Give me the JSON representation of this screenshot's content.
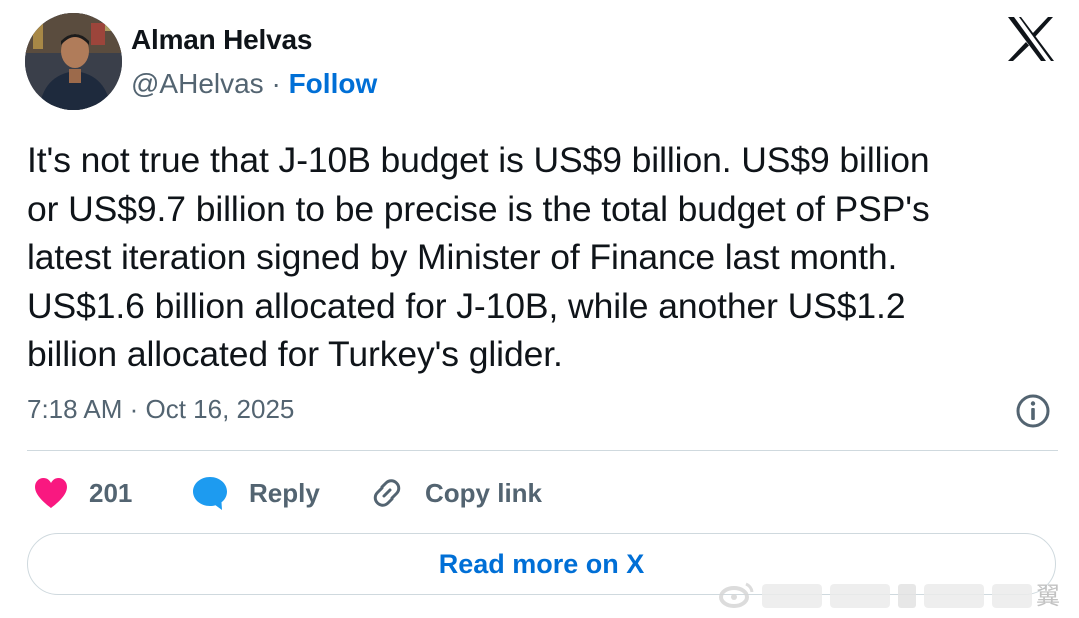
{
  "author": {
    "name": "Alman Helvas",
    "handle": "@AHelvas",
    "separator": " · ",
    "follow_label": "Follow"
  },
  "tweet": {
    "text": "It's not true that J-10B budget is US$9 billion. US$9 billion\nor US$9.7 billion to be precise is the total budget of PSP's\nlatest iteration signed by Minister of Finance last month.\nUS$1.6 billion allocated for J-10B, while another US$1.2\nbillion allocated for Turkey's glider.",
    "timestamp": "7:18 AM · Oct 16, 2025"
  },
  "actions": {
    "like_count": "201",
    "reply_label": "Reply",
    "copy_link_label": "Copy link"
  },
  "read_more_label": "Read more on X",
  "watermark_glyph": "翼",
  "colors": {
    "text_primary": "#0f1419",
    "text_secondary": "#536471",
    "accent_blue": "#006fd6",
    "like_pink": "#f91880",
    "reply_blue": "#1d9bf0",
    "divider": "#cfd9de"
  },
  "icons": {
    "brand": "x-logo-icon",
    "info": "info-icon",
    "like": "heart-icon",
    "reply": "speech-bubble-icon",
    "copy": "link-icon"
  }
}
